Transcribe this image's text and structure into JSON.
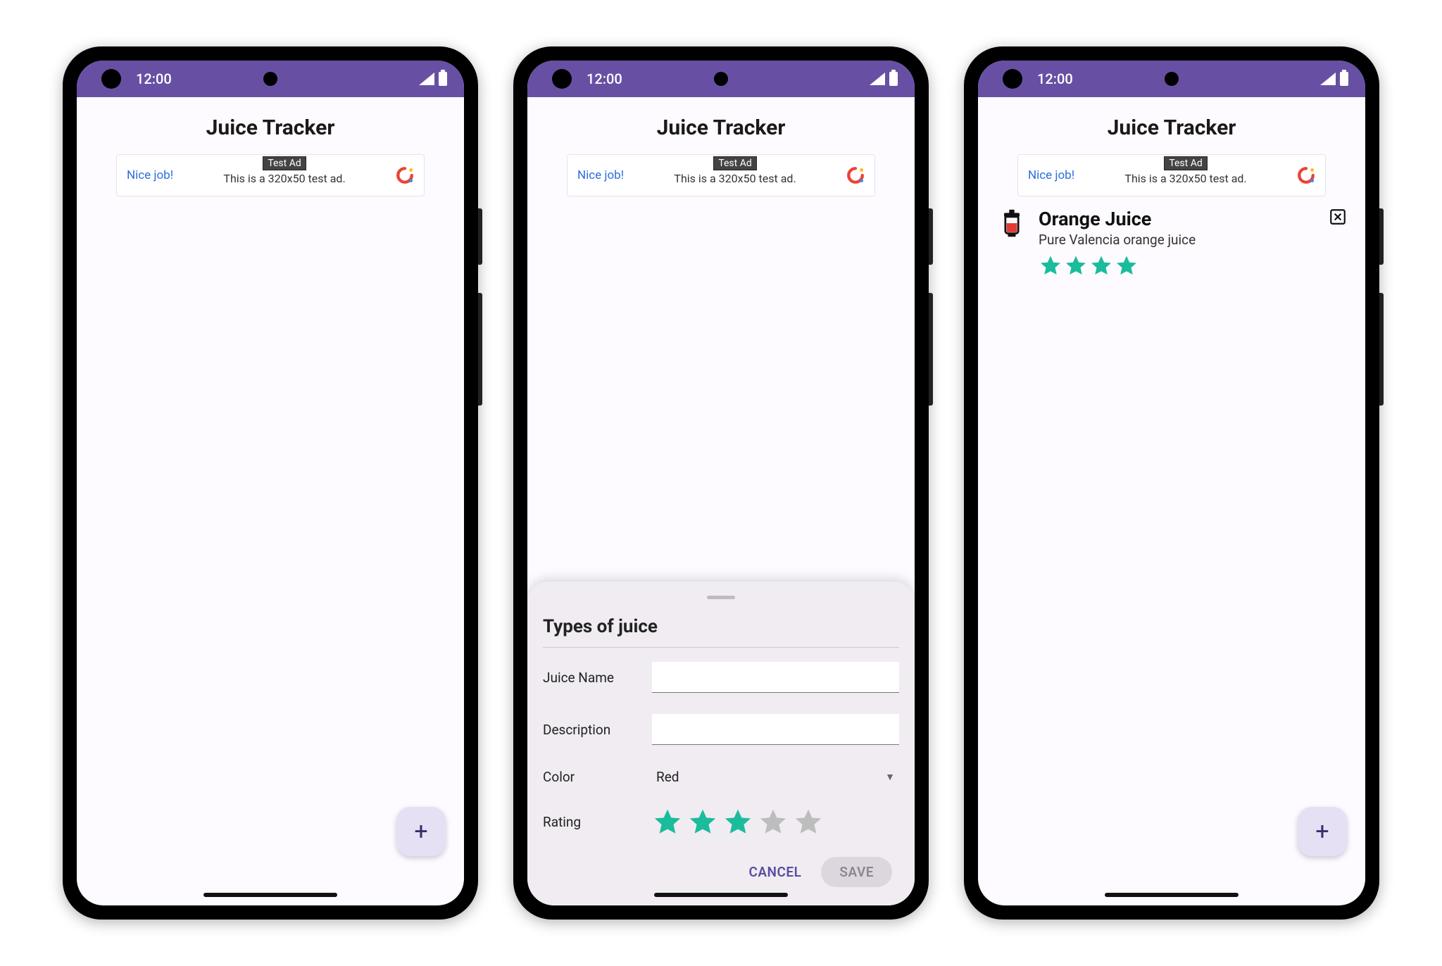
{
  "status_bar": {
    "time": "12:00"
  },
  "app_title": "Juice Tracker",
  "ad": {
    "nice": "Nice job!",
    "badge": "Test Ad",
    "text": "This is a 320x50 test ad."
  },
  "fab_label": "+",
  "sheet": {
    "title": "Types of juice",
    "labels": {
      "name": "Juice Name",
      "description": "Description",
      "color": "Color",
      "rating": "Rating"
    },
    "fields": {
      "name_value": "",
      "description_value": "",
      "color_value": "Red"
    },
    "rating_value": 3,
    "rating_max": 5,
    "buttons": {
      "cancel": "CANCEL",
      "save": "SAVE"
    }
  },
  "list": {
    "items": [
      {
        "name": "Orange Juice",
        "description": "Pure Valencia orange juice",
        "rating": 4,
        "rating_max": 5,
        "icon_color": "#e53935"
      }
    ]
  },
  "colors": {
    "primary": "#6750a4",
    "star_filled": "#1abc9c",
    "star_empty": "#bdbdbd",
    "fab_bg": "#e6e0f5"
  }
}
